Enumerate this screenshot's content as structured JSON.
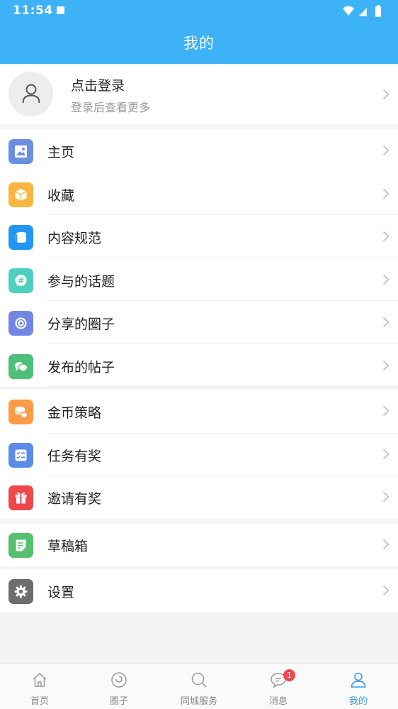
{
  "status_bar": {
    "time": "11:54"
  },
  "header": {
    "title": "我的"
  },
  "login": {
    "title": "点击登录",
    "subtitle": "登录后查看更多"
  },
  "groups": [
    {
      "items": [
        {
          "label": "主页",
          "icon": "image-icon",
          "color": "#6b8fe0"
        },
        {
          "label": "收藏",
          "icon": "box-icon",
          "color": "#f9b63f"
        },
        {
          "label": "内容规范",
          "icon": "shield-card-icon",
          "color": "#2196f3"
        },
        {
          "label": "参与的话题",
          "icon": "hashtag-bubble-icon",
          "color": "#4dd0c0"
        },
        {
          "label": "分享的圈子",
          "icon": "circle-swirl-icon",
          "color": "#7286e6"
        },
        {
          "label": "发布的帖子",
          "icon": "chat-bubbles-icon",
          "color": "#4cbf78"
        }
      ]
    },
    {
      "items": [
        {
          "label": "金币策略",
          "icon": "coins-icon",
          "color": "#ff9a46"
        },
        {
          "label": "任务有奖",
          "icon": "task-list-icon",
          "color": "#5a8be6"
        },
        {
          "label": "邀请有奖",
          "icon": "gift-icon",
          "color": "#f0474b"
        }
      ]
    },
    {
      "items": [
        {
          "label": "草稿箱",
          "icon": "draft-icon",
          "color": "#55c06e"
        }
      ]
    },
    {
      "items": [
        {
          "label": "设置",
          "icon": "gear-icon",
          "color": "#6d6d6d"
        }
      ]
    }
  ],
  "tabbar": {
    "tabs": [
      {
        "label": "首页",
        "icon": "home-icon"
      },
      {
        "label": "圈子",
        "icon": "circle-icon"
      },
      {
        "label": "同城服务",
        "icon": "search-icon"
      },
      {
        "label": "消息",
        "icon": "message-icon",
        "badge": "1"
      },
      {
        "label": "我的",
        "icon": "user-icon",
        "active": true
      }
    ]
  },
  "colors": {
    "primary": "#3db2f6",
    "active_tab": "#3b9be9",
    "badge": "#f0474b"
  }
}
